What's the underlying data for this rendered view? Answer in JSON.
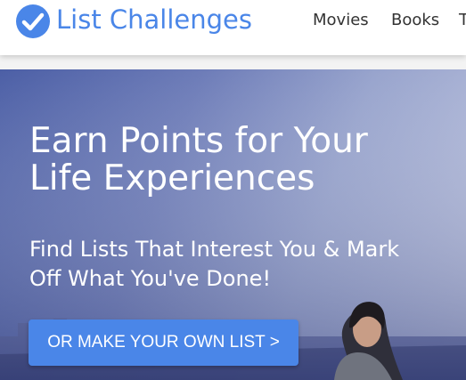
{
  "header": {
    "logo_text": "List Challenges",
    "nav": [
      "Movies",
      "Books",
      "T"
    ]
  },
  "hero": {
    "title_lines": [
      "Earn Points for Your",
      "Life Experiences"
    ],
    "subtitle_lines": [
      "Find Lists That Interest You & Mark",
      "Off What You've Done!"
    ],
    "cta_label": "OR MAKE YOUR OWN LIST >"
  },
  "colors": {
    "brand_blue": "#4a86e8",
    "nav_text": "#333333",
    "hero_text": "#ffffff"
  },
  "icons": {
    "logo": "checkmark-circle-icon"
  }
}
